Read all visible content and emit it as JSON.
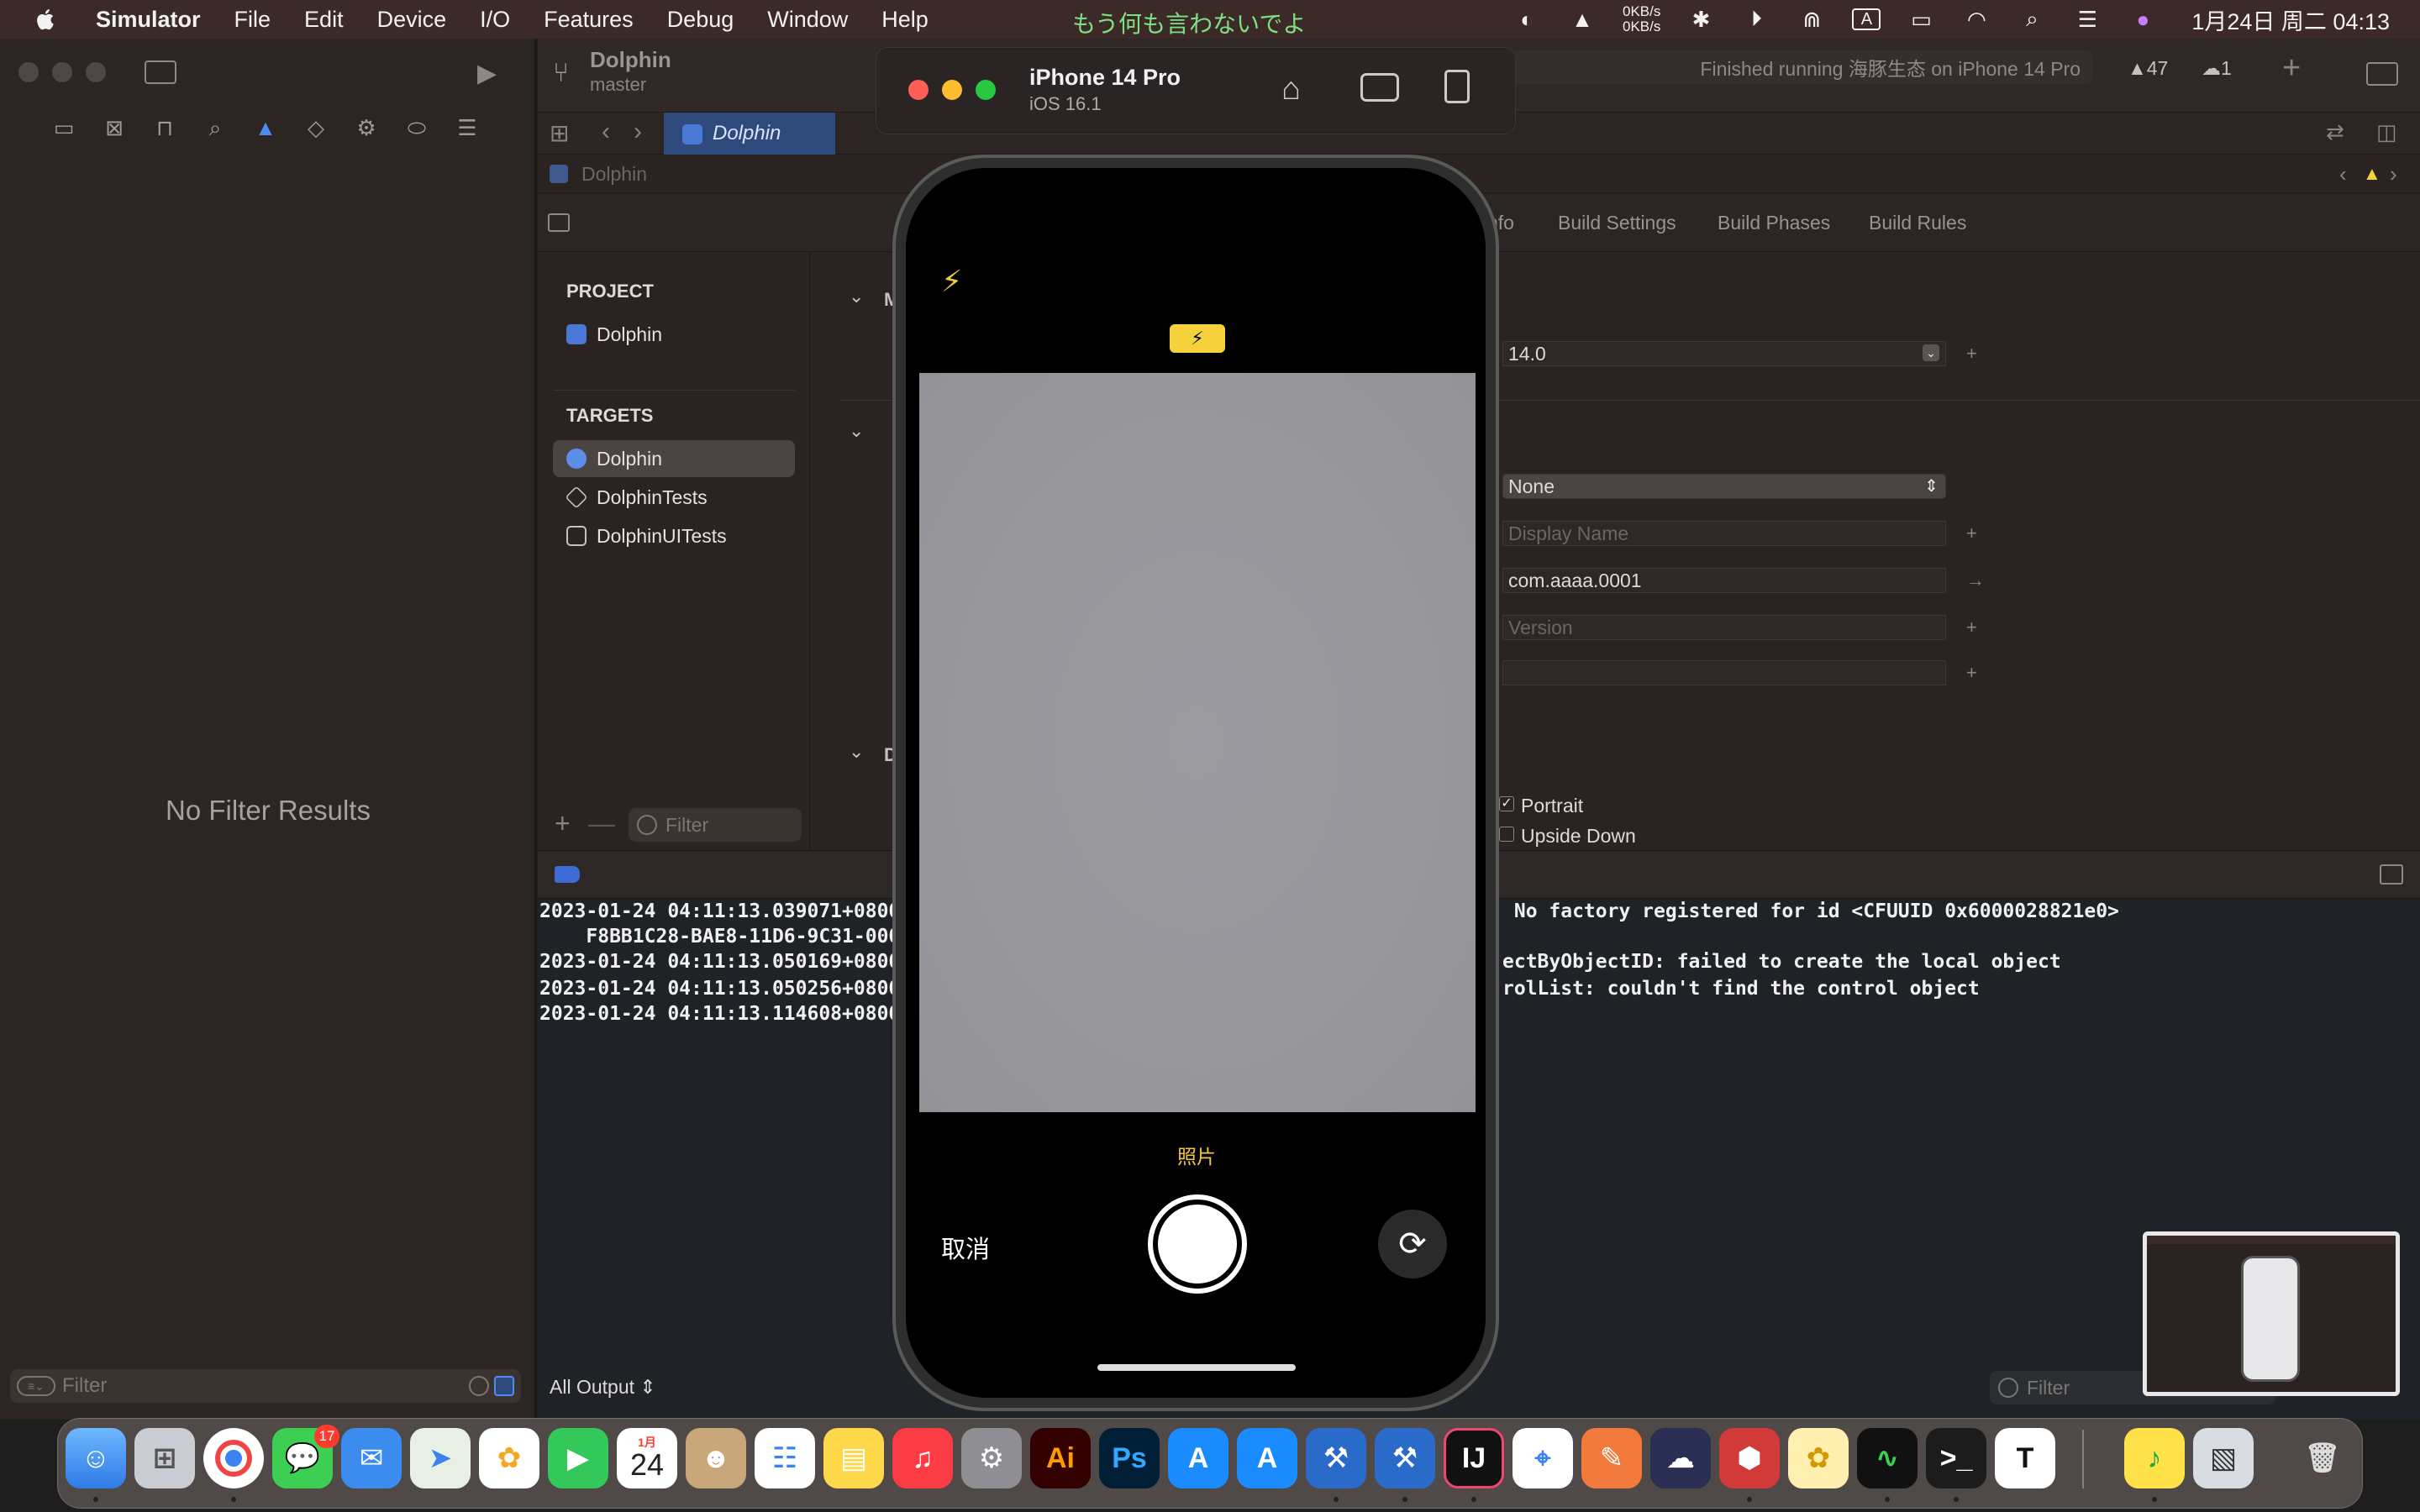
{
  "menubar": {
    "app_name": "Simulator",
    "items": [
      "File",
      "Edit",
      "Device",
      "I/O",
      "Features",
      "Debug",
      "Window",
      "Help"
    ],
    "banner": "もう何も言わないでよ",
    "net_up": "0KB/s",
    "net_down": "0KB/s",
    "input_method": "A",
    "clock": "1月24日 周二  04:13"
  },
  "xcode": {
    "scheme_name": "Dolphin",
    "branch": "master",
    "status": "Finished running 海豚生态 on iPhone 14 Pro",
    "warnings": "47",
    "issues": "1",
    "tab": "Dolphin",
    "jumpbar": "Dolphin",
    "settings_tabs": [
      "nfo",
      "Build Settings",
      "Build Phases",
      "Build Rules"
    ],
    "navigator_empty": "No Filter Results",
    "navigator_filter_placeholder": "Filter",
    "project_header": "PROJECT",
    "project_item": "Dolphin",
    "targets_header": "TARGETS",
    "targets": [
      "Dolphin",
      "DolphinTests",
      "DolphinUITests"
    ],
    "list_filter_placeholder": "Filter",
    "section_letters": [
      "M",
      "D"
    ],
    "fields": {
      "deployment": "14.0",
      "category": "None",
      "display_name_placeholder": "Display Name",
      "bundle_id": "com.aaaa.0001",
      "version_placeholder": "Version",
      "build": ""
    },
    "orientation": [
      "Portrait",
      "Upside Down"
    ],
    "console": {
      "lines_left": [
        "2023-01-24 04:11:13.039071+0800",
        "    F8BB1C28-BAE8-11D6-9C31-000",
        "2023-01-24 04:11:13.050169+0800",
        "2023-01-24 04:11:13.050256+0800",
        "2023-01-24 04:11:13.114608+0800"
      ],
      "lines_right": [
        " No factory registered for id <CFUUID 0x6000028821e0>",
        "",
        "ectByObjectID: failed to create the local object",
        "rolList: couldn't find the control object",
        ""
      ],
      "output_selector": "All Output",
      "filter_placeholder": "Filter"
    }
  },
  "simulator": {
    "device": "iPhone 14 Pro",
    "os": "iOS 16.1",
    "camera_mode": "照片",
    "cancel": "取消"
  },
  "dock": {
    "messages_badge": "17",
    "calendar_month": "1月",
    "calendar_day": "24",
    "apps": [
      "finder-icon",
      "launchpad-icon",
      "chrome-icon",
      "messages-icon",
      "mail-icon",
      "maps-icon",
      "photos-icon",
      "facetime-icon",
      "calendar-icon",
      "contacts-icon",
      "reminders-icon",
      "notes-icon",
      "music-icon",
      "system-settings-icon",
      "illustrator-icon",
      "photoshop-icon",
      "app-store-icon",
      "xcode-instruments-icon",
      "xcode-icon",
      "simulator-icon",
      "intellij-icon",
      "maps-pin-icon",
      "pencil-app-icon",
      "cloud-app-icon",
      "xcode-red-icon",
      "paw-app-icon",
      "activity-monitor-icon",
      "terminal-icon",
      "typora-icon",
      "qq-music-icon",
      "preview-icon",
      "trash-icon"
    ],
    "labels": {
      "illustrator": "Ai",
      "photoshop": "Ps",
      "intellij": "IJ",
      "typora": "T"
    }
  },
  "colors": {
    "menubar_bg": "#3c2a28",
    "accent_blue": "#2e4a7a",
    "warning_yellow": "#f5d23c",
    "camera_yellow": "#f3c744"
  }
}
